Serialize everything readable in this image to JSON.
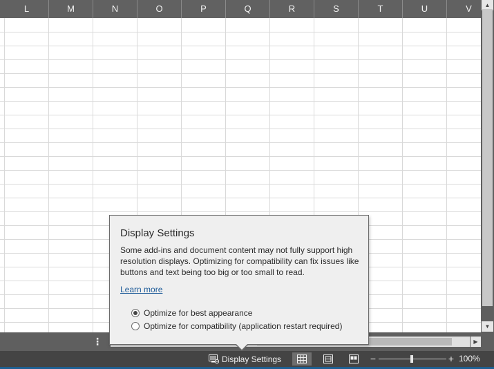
{
  "columns": [
    "L",
    "M",
    "N",
    "O",
    "P",
    "Q",
    "R",
    "S",
    "T",
    "U",
    "V"
  ],
  "status_bar": {
    "display_settings_label": "Display Settings",
    "zoom_minus": "−",
    "zoom_plus": "+",
    "zoom_level": "100%",
    "zoom_percent": 100,
    "active_view": "normal"
  },
  "tab_bar": {
    "options_icon": "vertical-ellipsis-icon"
  },
  "callout": {
    "title": "Display Settings",
    "body": "Some add-ins and document content may not fully support high resolution displays.  Optimizing for compatibility can fix issues like buttons and text being too big or too small to read.",
    "learn_more": "Learn more",
    "options": [
      {
        "label": "Optimize for best appearance",
        "selected": true
      },
      {
        "label": "Optimize for compatibility (application restart required)",
        "selected": false
      }
    ]
  },
  "colors": {
    "header_bg": "#616161",
    "status_bg": "#444444",
    "link": "#1f5c99",
    "callout_bg": "#efefef",
    "gridline": "#d9d9d9"
  }
}
